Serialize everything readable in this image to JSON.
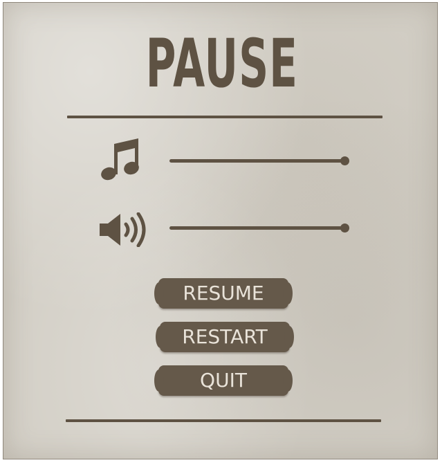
{
  "menu": {
    "title": "PAUSE",
    "buttons": {
      "resume": "RESUME",
      "restart": "RESTART",
      "quit": "QUIT"
    }
  },
  "settings": {
    "music": {
      "icon": "music-note-icon",
      "volume": 1.0
    },
    "sfx": {
      "icon": "speaker-volume-icon",
      "volume": 1.0
    }
  },
  "colors": {
    "ink": "#5e5243",
    "button": "#65594a",
    "button_text": "#e9e3d9",
    "paper": "#d3cfc6"
  }
}
